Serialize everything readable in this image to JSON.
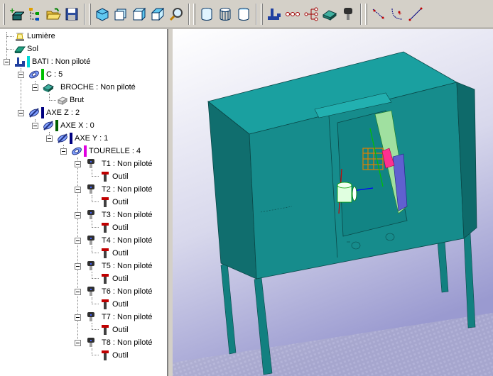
{
  "toolbar": {
    "groups": [
      [
        "new-part-icon",
        "tree-structure-icon",
        "open-folder-icon",
        "save-disk-icon"
      ],
      [
        "cube-view-front-icon",
        "cube-view-side-icon",
        "cube-view-top-icon",
        "cube-view-iso-icon",
        "zoom-magnifier-icon"
      ],
      [
        "cylinder-solid-icon",
        "cylinder-wire-icon",
        "cylinder-shaded-icon"
      ],
      [
        "axis-machine-icon",
        "chain-link-icon",
        "joint-tree-icon",
        "stock-block-icon",
        "tool-holder-icon"
      ],
      [
        "trajectory-points-icon",
        "trajectory-curve-icon",
        "measure-line-icon"
      ]
    ]
  },
  "tree": {
    "lumiere": "Lumière",
    "sol": "Sol",
    "bati": "BATI : Non piloté",
    "c": "C : 5",
    "broche": "BROCHE : Non piloté",
    "brut": "Brut",
    "axe_z": "AXE Z : 2",
    "axe_x": "AXE X : 0",
    "axe_y": "AXE Y : 1",
    "tourelle": "TOURELLE : 4",
    "tools": [
      {
        "label": "T1 : Non piloté",
        "child": "Outil"
      },
      {
        "label": "T2 : Non piloté",
        "child": "Outil"
      },
      {
        "label": "T3 : Non piloté",
        "child": "Outil"
      },
      {
        "label": "T4 : Non piloté",
        "child": "Outil"
      },
      {
        "label": "T5 : Non piloté",
        "child": "Outil"
      },
      {
        "label": "T6 : Non piloté",
        "child": "Outil"
      },
      {
        "label": "T7 : Non piloté",
        "child": "Outil"
      },
      {
        "label": "T8 : Non piloté",
        "child": "Outil"
      }
    ]
  },
  "colors": {
    "bati_bar": "#00d8d8",
    "c_bar": "#00c000",
    "axe_z_bar": "#000080",
    "axe_x_bar": "#006000",
    "axe_y_bar": "#000080",
    "tourelle_bar": "#e000e0",
    "machine": "#168c8c",
    "background_top": "#ffffff",
    "background_bottom": "#9a9ad0"
  }
}
